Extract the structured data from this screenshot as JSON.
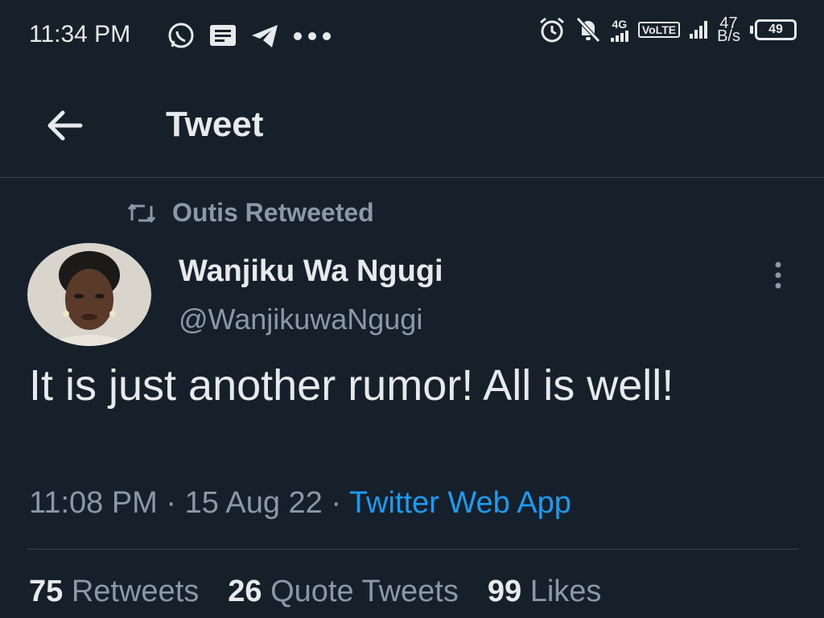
{
  "status_bar": {
    "time": "11:34 PM",
    "network_type": "4G",
    "volte": "VoLTE",
    "speed_value": "47",
    "speed_unit": "B/s",
    "battery": "49"
  },
  "header": {
    "title": "Tweet"
  },
  "tweet": {
    "retweeted_by": "Outis Retweeted",
    "author_name": "Wanjiku Wa Ngugi",
    "author_handle": "@WanjikuwaNgugi",
    "text": "It is just another rumor!  All is well!",
    "time": "11:08 PM",
    "date": "15 Aug 22",
    "source": "Twitter Web App"
  },
  "stats": [
    {
      "count": "75",
      "label": "Retweets"
    },
    {
      "count": "26",
      "label": "Quote Tweets"
    },
    {
      "count": "99",
      "label": "Likes"
    }
  ],
  "colors": {
    "background": "#15202b",
    "text_primary": "#e7e9ea",
    "text_secondary": "#8b98a5",
    "accent": "#1d9bf0",
    "divider": "#38444d"
  },
  "icons": [
    "whatsapp-icon",
    "message-icon",
    "telegram-icon",
    "more-notifications-icon",
    "alarm-icon",
    "mute-icon",
    "signal-icon",
    "battery-icon",
    "back-arrow-icon",
    "retweet-icon",
    "more-options-icon"
  ]
}
